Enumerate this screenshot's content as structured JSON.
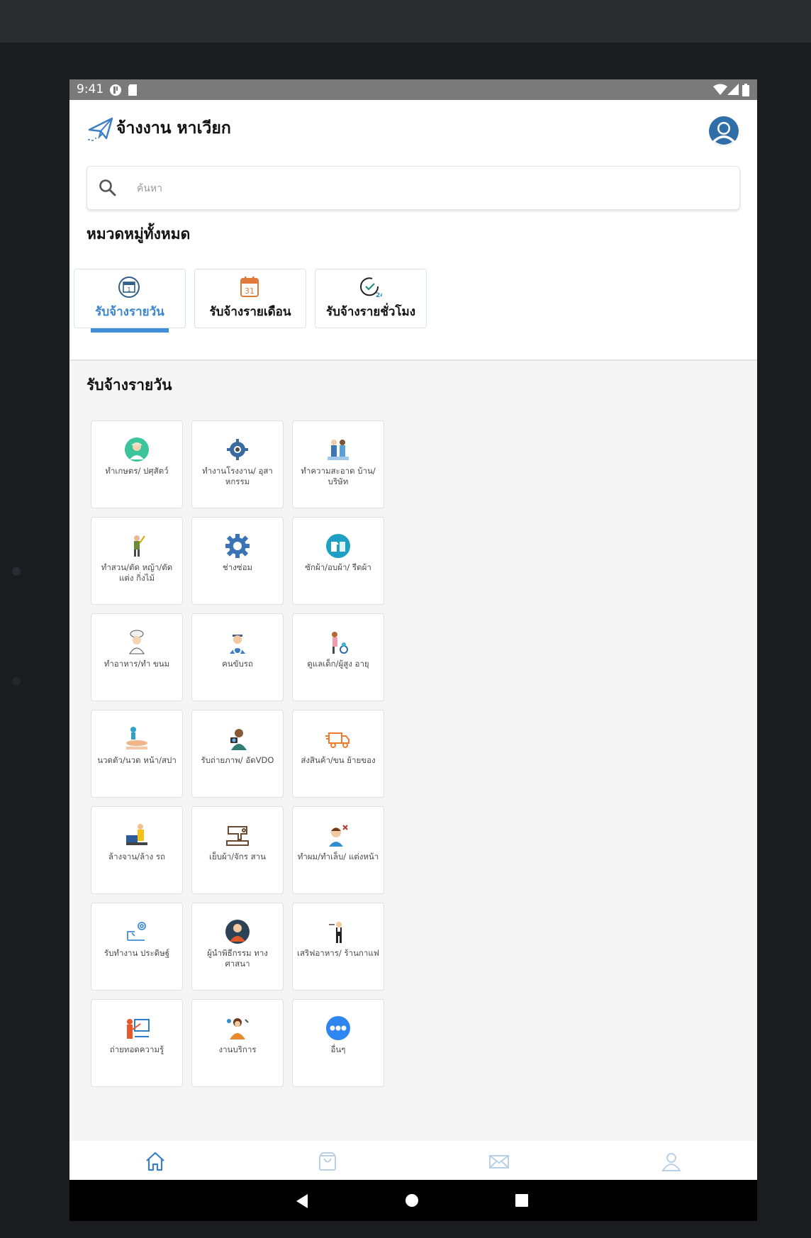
{
  "status_bar": {
    "time": "9:41"
  },
  "app": {
    "title": "จ้างงาน หาเวียก"
  },
  "search": {
    "placeholder": "ค้นหา"
  },
  "categories_heading": "หมวดหมู่ทั้งหมด",
  "category_tabs": [
    {
      "label": "รับจ้างรายวัน",
      "icon": "calendar-day-icon",
      "active": true
    },
    {
      "label": "รับจ้างรายเดือน",
      "icon": "calendar-31-icon",
      "active": false
    },
    {
      "label": "รับจ้างรายชั่วโมง",
      "icon": "clock-24-icon",
      "active": false
    }
  ],
  "section_heading": "รับจ้างรายวัน",
  "services": [
    {
      "label": "ทำเกษตร/ ปศุสัตว์",
      "icon": "farmer-icon"
    },
    {
      "label": "ทำงานโรงงาน/ อุสาหกรรม",
      "icon": "factory-gear-icon"
    },
    {
      "label": "ทำความสะอาด บ้าน/บริษัท",
      "icon": "cleaner-icon"
    },
    {
      "label": "ทำสวน/ตัด หญ้า/ตัดแต่ง กิ่งไม้",
      "icon": "gardener-icon"
    },
    {
      "label": "ช่างซ่อม",
      "icon": "gear-icon"
    },
    {
      "label": "ซักผ้า/อบผ้า/ รีดผ้า",
      "icon": "laundry-icon"
    },
    {
      "label": "ทำอาหาร/ทำ ขนม",
      "icon": "chef-icon"
    },
    {
      "label": "คนขับรถ",
      "icon": "driver-icon"
    },
    {
      "label": "ดูแลเด็ก/ผู้สูง อายุ",
      "icon": "caregiver-icon"
    },
    {
      "label": "นวดตัว/นวด หน้า/สปา",
      "icon": "massage-icon"
    },
    {
      "label": "รับถ่ายภาพ/ อัดVDO",
      "icon": "photographer-icon"
    },
    {
      "label": "ส่งสินค้า/ขน ย้ายของ",
      "icon": "delivery-truck-icon"
    },
    {
      "label": "ล้างจาน/ล้าง รถ",
      "icon": "dishwasher-icon"
    },
    {
      "label": "เย็บผ้า/จักร สาน",
      "icon": "sewing-machine-icon"
    },
    {
      "label": "ทำผม/ทำเล็บ/ แต่งหน้า",
      "icon": "hairdresser-icon"
    },
    {
      "label": "รับทำงาน ประดิษฐ์",
      "icon": "craft-icon"
    },
    {
      "label": "ผู้นำพิธีกรรม ทางศาสนา",
      "icon": "monk-icon"
    },
    {
      "label": "เสริฟอาหาร/ ร้านกาแฟ",
      "icon": "waiter-icon"
    },
    {
      "label": "ถ่ายทอดความรู้",
      "icon": "teacher-icon"
    },
    {
      "label": "งานบริการ",
      "icon": "service-worker-icon"
    },
    {
      "label": "อื่นๆ",
      "icon": "more-dots-icon"
    }
  ],
  "bottom_nav": [
    "home-icon",
    "shopping-bag-icon",
    "mail-icon",
    "profile-icon"
  ],
  "colors": {
    "accent": "#3f8ddb",
    "status_bar": "#7a7a7a",
    "active_nav": "#3a7fc8",
    "inactive_nav": "#b9cfe6"
  }
}
